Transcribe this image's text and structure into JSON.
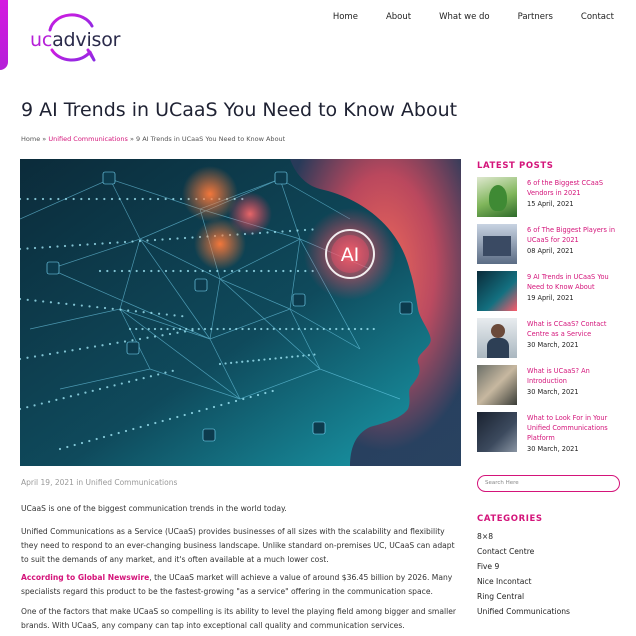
{
  "brand": {
    "logo_uc": "uc",
    "logo_rest": "advisor"
  },
  "nav": [
    {
      "label": "Home"
    },
    {
      "label": "About"
    },
    {
      "label": "What we do"
    },
    {
      "label": "Partners"
    },
    {
      "label": "Contact"
    }
  ],
  "article": {
    "title": "9 AI Trends in UCaaS You Need to Know About",
    "breadcrumb": {
      "home": "Home",
      "sep1": " » ",
      "category": "Unified Communications",
      "sep2": " » ",
      "current": "9 AI Trends in UCaaS You Need to Know About"
    },
    "hero_badge": "AI",
    "meta": "April 19, 2021 in Unified Communications",
    "p1": "UCaaS is one of the biggest communication trends in the world today.",
    "p2": "Unified Communications as a Service (UCaaS) provides businesses of all sizes with the scalability and flexibility they need to respond to an ever-changing business landscape. Unlike standard on-premises UC, UCaaS can adapt to suit the demands of any market, and it's often available at a much lower cost.",
    "p3_link": "According to Global Newswire",
    "p3_rest": ", the UCaaS market will achieve a value of around $36.45 billion by 2026. Many specialists regard this product to be the fastest-growing \"as a service\" offering in the communication space.",
    "p4": "One of the factors that make UCaaS so compelling is its ability to level the playing field among bigger and smaller brands. With UCaaS, any company can tap into exceptional call quality and communication services."
  },
  "sidebar": {
    "latest_heading": "LATEST POSTS",
    "posts": [
      {
        "title": "6 of the Biggest CCaaS Vendors in 2021",
        "date": "15 April, 2021"
      },
      {
        "title": "6 of The Biggest Players in UCaaS for 2021",
        "date": "08 April, 2021"
      },
      {
        "title": "9 AI Trends in UCaaS You Need to Know About",
        "date": "19 April, 2021"
      },
      {
        "title": "What is CCaaS? Contact Centre as a Service",
        "date": "30 March, 2021"
      },
      {
        "title": "What is UCaaS? An Introduction",
        "date": "30 March, 2021"
      },
      {
        "title": "What to Look For in Your Unified Communications Platform",
        "date": "30 March, 2021"
      }
    ],
    "search_placeholder": "Search Here",
    "categories_heading": "CATEGORIES",
    "categories": [
      "8×8",
      "Contact Centre",
      "Five 9",
      "Nice Incontact",
      "Ring Central",
      "Unified Communications"
    ]
  },
  "colors": {
    "accent": "#d4147a",
    "brand": "#b51fd8",
    "text": "#1f2233"
  }
}
